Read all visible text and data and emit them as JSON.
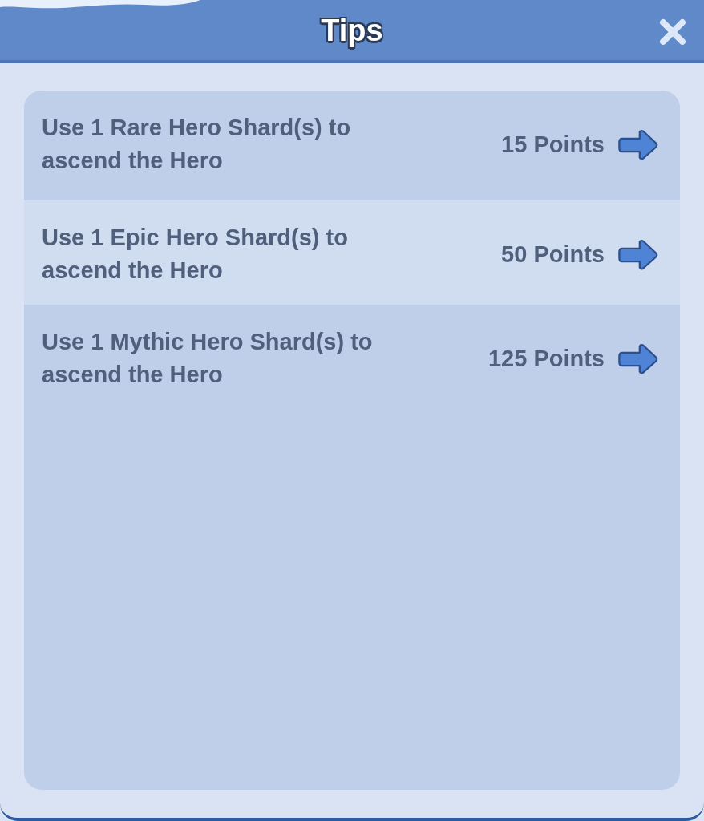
{
  "window": {
    "title": "Tips"
  },
  "tips": [
    {
      "text": "Use 1 Rare Hero Shard(s) to ascend the Hero",
      "points": "15 Points"
    },
    {
      "text": "Use 1 Epic Hero Shard(s) to ascend the Hero",
      "points": "50 Points"
    },
    {
      "text": "Use 1 Mythic Hero Shard(s) to ascend the Hero",
      "points": "125 Points"
    }
  ]
}
